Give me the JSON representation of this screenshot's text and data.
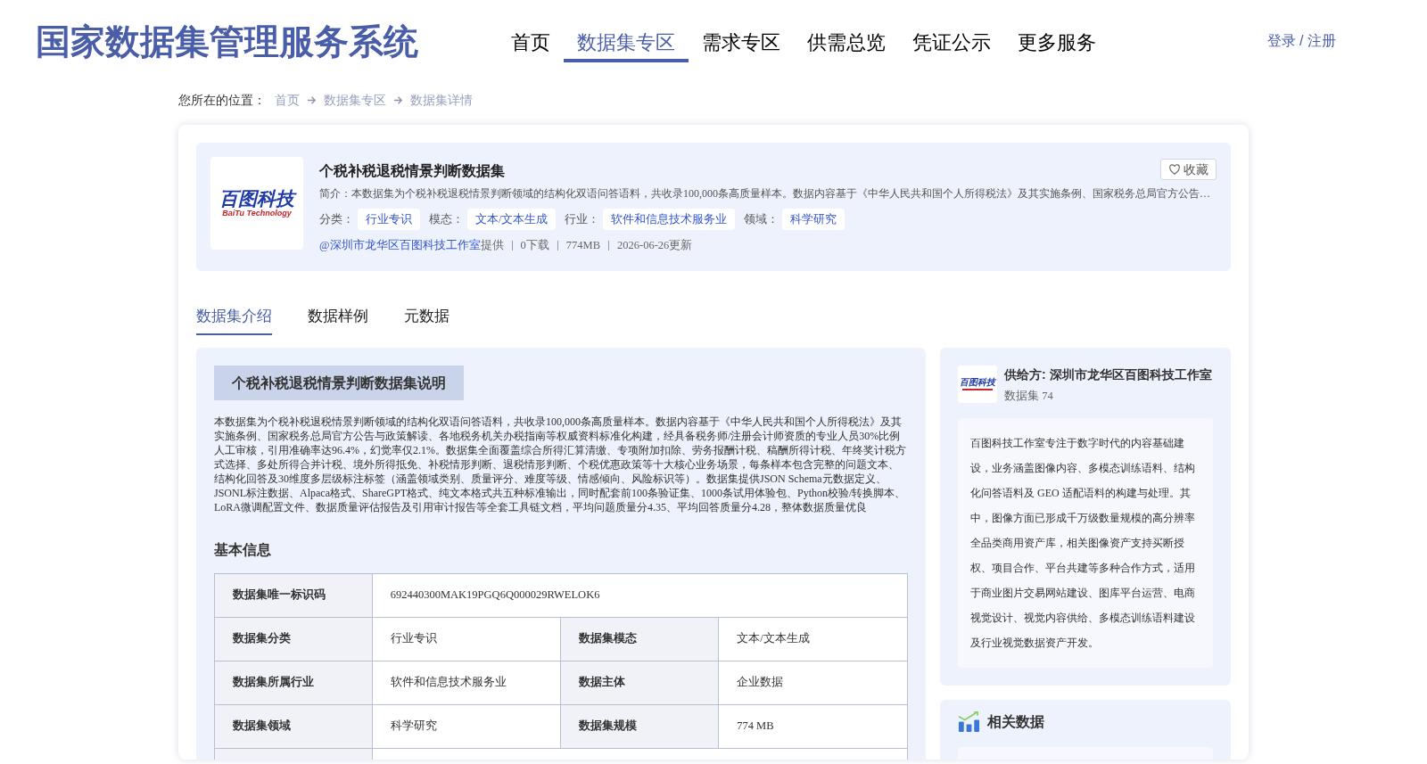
{
  "site_title": "国家数据集管理服务系统",
  "nav": [
    {
      "label": "首页",
      "selected": false
    },
    {
      "label": "数据集专区",
      "selected": true
    },
    {
      "label": "需求专区",
      "selected": false
    },
    {
      "label": "供需总览",
      "selected": false
    },
    {
      "label": "凭证公示",
      "selected": false
    },
    {
      "label": "更多服务",
      "selected": false
    }
  ],
  "login": "登录 / 注册",
  "breadcrumb": {
    "label": "您所在的位置：",
    "items": [
      "首页",
      "数据集专区",
      "数据集详情"
    ]
  },
  "dataset": {
    "logo_text": "百图科技",
    "logo_subtext": "BaiTu Technology",
    "title": "个税补税退税情景判断数据集",
    "favorite": "收藏",
    "summary": "简介：本数据集为个税补税退税情景判断领域的结构化双语问答语料，共收录100,000条高质量样本。数据内容基于《中华人民共和国个人所得税法》及其实施条例、国家税务总局官方公告…",
    "tags": [
      {
        "label": "分类：",
        "value": "行业专识"
      },
      {
        "label": "模态：",
        "value": "文本/文本生成"
      },
      {
        "label": "行业：",
        "value": "软件和信息技术服务业"
      },
      {
        "label": "领域：",
        "value": "科学研究"
      }
    ],
    "provider_link": "@深圳市龙华区百图科技工作室",
    "provider_suffix": "提供",
    "meta": [
      "0下载",
      "774MB",
      "2026-06-26更新"
    ]
  },
  "tabs": [
    {
      "label": "数据集介绍",
      "selected": true
    },
    {
      "label": "数据样例",
      "selected": false
    },
    {
      "label": "元数据",
      "selected": false
    }
  ],
  "intro": {
    "heading": "个税补税退税情景判断数据集说明",
    "text": "本数据集为个税补税退税情景判断领域的结构化双语问答语料，共收录100,000条高质量样本。数据内容基于《中华人民共和国个人所得税法》及其实施条例、国家税务总局官方公告与政策解读、各地税务机关办税指南等权威资料标准化构建，经具备税务师/注册会计师资质的专业人员30%比例人工审核，引用准确率达96.4%，幻觉率仅2.1%。数据集全面覆盖综合所得汇算清缴、专项附加扣除、劳务报酬计税、稿酬所得计税、年终奖计税方式选择、多处所得合并计税、境外所得抵免、补税情形判断、退税情形判断、个税优惠政策等十大核心业务场景，每条样本包含完整的问题文本、结构化回答及30维度多层级标注标签（涵盖领域类别、质量评分、难度等级、情感倾向、风险标识等）。数据集提供JSON Schema元数据定义、JSONL标注数据、Alpaca格式、ShareGPT格式、纯文本格式共五种标准输出，同时配套前100条验证集、1000条试用体验包、Python校验/转换脚本、LoRA微调配置文件、数据质量评估报告及引用审计报告等全套工具链文档，平均问题质量分4.35、平均回答质量分4.28，整体数据质量优良",
    "basic_info_heading": "基本信息",
    "rows": [
      [
        {
          "label": "数据集唯一标识码",
          "value": "692440300MAK19PGQ6Q000029RWELOK6"
        }
      ],
      [
        {
          "label": "数据集分类",
          "value": "行业专识"
        },
        {
          "label": "数据集模态",
          "value": "文本/文本生成"
        }
      ],
      [
        {
          "label": "数据集所属行业",
          "value": "软件和信息技术服务业"
        },
        {
          "label": "数据主体",
          "value": "企业数据"
        }
      ],
      [
        {
          "label": "数据集领域",
          "value": "科学研究"
        },
        {
          "label": "数据集规模",
          "value": "774 MB"
        }
      ]
    ]
  },
  "provider": {
    "logo_text": "百图科技",
    "name": "供给方: 深圳市龙华区百图科技工作室",
    "count": "数据集 74",
    "description": "百图科技工作室专注于数字时代的内容基础建设，业务涵盖图像内容、多模态训练语料、结构化问答语料及 GEO 适配语料的构建与处理。其中，图像方面已形成千万级数量规模的高分辨率全品类商用资产库，相关图像资产支持买断授权、项目合作、平台共建等多种合作方式，适用于商业图片交易网站建设、图库平台运营、电商视觉设计、视觉内容供给、多模态训练语料建设及行业视觉数据资产开发。"
  },
  "related": {
    "heading": "相关数据"
  }
}
